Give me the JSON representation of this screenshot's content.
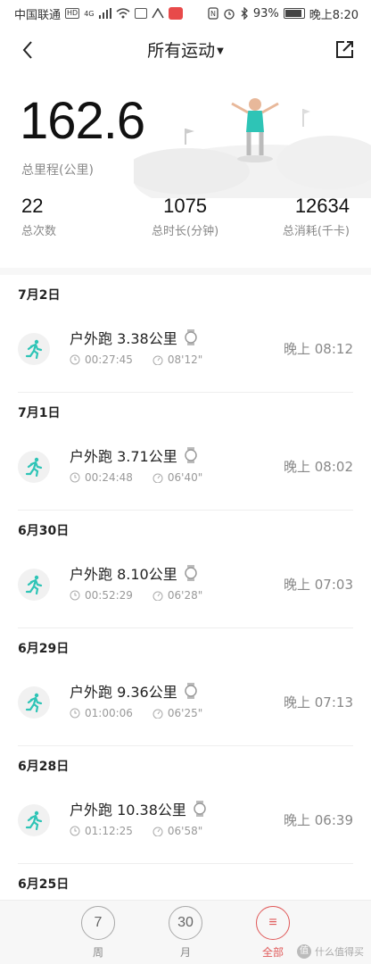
{
  "status_bar": {
    "carrier": "中国联通",
    "network_tag": "HD",
    "signal_tag": "4G",
    "battery": "93%",
    "time": "晚上8:20"
  },
  "header": {
    "title": "所有运动"
  },
  "summary": {
    "total_distance": "162.6",
    "total_distance_label": "总里程(公里)",
    "count": "22",
    "count_label": "总次数",
    "duration": "1075",
    "duration_label": "总时长(分钟)",
    "calories": "12634",
    "calories_label": "总消耗(千卡)"
  },
  "groups": [
    {
      "date": "7月2日",
      "activity": "户外跑 3.38公里",
      "duration": "00:27:45",
      "pace": "08'12\"",
      "time": "晚上 08:12"
    },
    {
      "date": "7月1日",
      "activity": "户外跑 3.71公里",
      "duration": "00:24:48",
      "pace": "06'40\"",
      "time": "晚上 08:02"
    },
    {
      "date": "6月30日",
      "activity": "户外跑 8.10公里",
      "duration": "00:52:29",
      "pace": "06'28\"",
      "time": "晚上 07:03"
    },
    {
      "date": "6月29日",
      "activity": "户外跑 9.36公里",
      "duration": "01:00:06",
      "pace": "06'25\"",
      "time": "晚上 07:13"
    },
    {
      "date": "6月28日",
      "activity": "户外跑 10.38公里",
      "duration": "01:12:25",
      "pace": "06'58\"",
      "time": "晚上 06:39"
    }
  ],
  "partial_date": "6月25日",
  "tabs": [
    {
      "num": "7",
      "label": "周"
    },
    {
      "num": "30",
      "label": "月"
    },
    {
      "num": "≡",
      "label": "全部"
    }
  ],
  "watermark": "什么值得买",
  "colors": {
    "accent": "#e05a5a",
    "run_icon": "#2ec4b6"
  }
}
